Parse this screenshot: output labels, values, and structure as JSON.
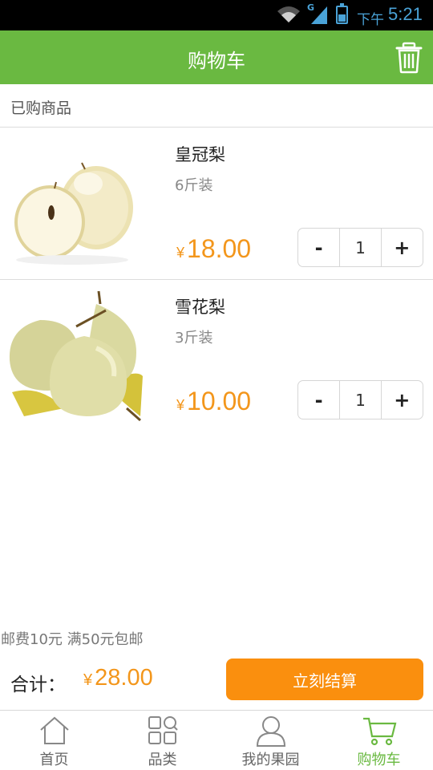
{
  "status_bar": {
    "network": "G",
    "ampm": "下午",
    "time": "5:21"
  },
  "header": {
    "title": "购物车",
    "action_icon": "trash-icon"
  },
  "cart": {
    "section_label": "已购商品",
    "items": [
      {
        "name": "皇冠梨",
        "spec": "6斤装",
        "currency": "¥",
        "price": "18.00",
        "quantity": "1",
        "minus": "-",
        "plus": "+"
      },
      {
        "name": "雪花梨",
        "spec": "3斤装",
        "currency": "¥",
        "price": "10.00",
        "quantity": "1",
        "minus": "-",
        "plus": "+"
      }
    ]
  },
  "footer": {
    "shipping_note": "邮费10元 满50元包邮",
    "total_label": "合计：",
    "total_currency": "¥",
    "total_price": "28.00",
    "checkout_label": "立刻结算"
  },
  "tabbar": {
    "tabs": [
      {
        "label": "首页",
        "icon": "home-icon"
      },
      {
        "label": "品类",
        "icon": "category-icon"
      },
      {
        "label": "我的果园",
        "icon": "user-icon"
      },
      {
        "label": "购物车",
        "icon": "cart-icon"
      }
    ],
    "active_index": 3
  },
  "colors": {
    "brand_green": "#6ab941",
    "price_orange": "#f3961b",
    "button_orange": "#fa8f0e",
    "status_blue": "#4aa3d8"
  }
}
